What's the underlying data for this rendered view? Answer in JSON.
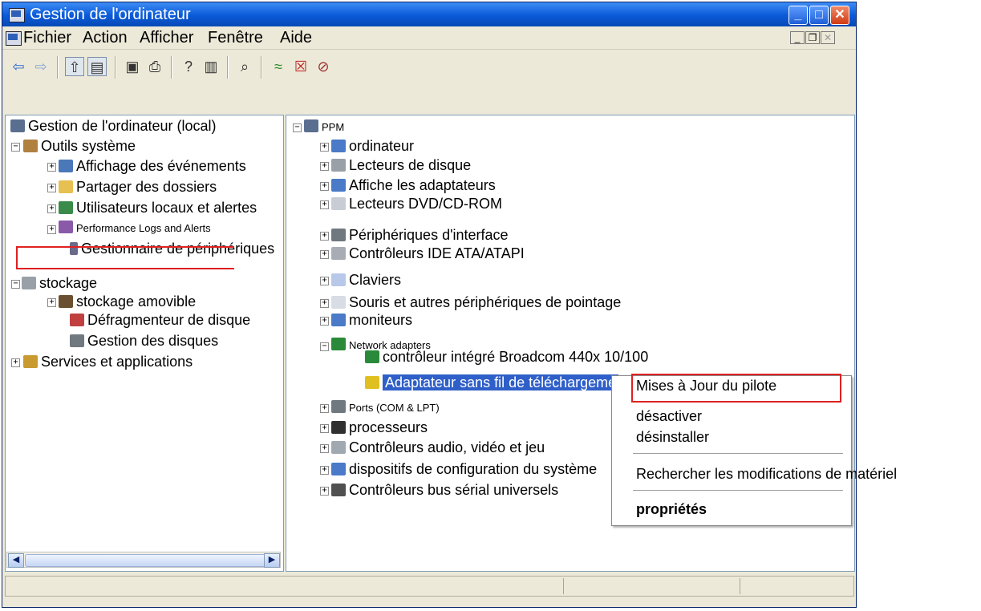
{
  "window": {
    "title": "Gestion de l'ordinateur"
  },
  "menu": {
    "items": [
      "Fichier",
      "Action",
      "Afficher",
      "Fenêtre",
      "Aide"
    ]
  },
  "toolbar": {
    "icons": [
      "back-arrow-icon",
      "forward-arrow-icon",
      "up-folder-icon",
      "show-hide-tree-icon",
      "properties-icon",
      "print-icon",
      "help-icon",
      "details-icon",
      "scan-hardware-icon",
      "update-driver-icon",
      "uninstall-icon",
      "disable-icon"
    ]
  },
  "left_tree": {
    "root": "Gestion de l'ordinateur (local)",
    "system_tools": "Outils système",
    "event_viewer": "Affichage des événements",
    "shared_folders": "Partager des dossiers",
    "local_users": "Utilisateurs locaux et alertes",
    "perf_logs": "Performance Logs and Alerts",
    "device_manager": "Gestionnaire de périphériques",
    "storage": "stockage",
    "removable_storage": "stockage amovible",
    "defrag": "Défragmenteur de disque",
    "disk_mgmt": "Gestion des disques",
    "services": "Services et applications"
  },
  "right_tree": {
    "root": "PPM",
    "computer": "ordinateur",
    "disk_drives": "Lecteurs de disque",
    "display": "Affiche les adaptateurs",
    "dvd": "Lecteurs DVD/CD-ROM",
    "hid": "Périphériques d'interface",
    "ide": "Contrôleurs IDE ATA/ATAPI",
    "keyboards": "Claviers",
    "mice": "Souris et autres périphériques de pointage",
    "monitors": "moniteurs",
    "network": "Network adapters",
    "broadcom": "contrôleur intégré Broadcom 440x 10/100",
    "wireless": "Adaptateur sans fil de téléchargeme",
    "ports": "Ports (COM & LPT)",
    "processors": "processeurs",
    "audio": "Contrôleurs audio, vidéo et jeu",
    "system_devices": "dispositifs de configuration du système",
    "usb": "Contrôleurs bus sérial universels"
  },
  "context_menu": {
    "update_driver": "Mises à Jour du pilote",
    "disable": "désactiver",
    "uninstall": "désinstaller",
    "scan": "Rechercher les modifications de matériel",
    "properties": "propriétés"
  },
  "colors": {
    "highlight": "#e02020",
    "selection": "#2f5fc8",
    "titlebar": "#0a5ad8"
  }
}
